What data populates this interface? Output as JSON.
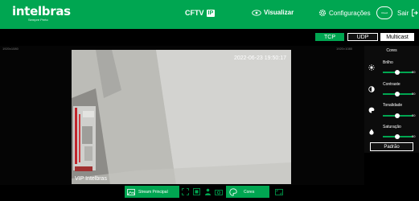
{
  "header": {
    "logo": "intelbras",
    "logo_tagline": "Sempre Perto",
    "product": "CFTV",
    "product_badge": "IP",
    "nav": {
      "visualizar": "Visualizar",
      "configuracoes": "Configurações",
      "cloud": "Cloud",
      "sair": "Sair"
    },
    "accent_color": "#00a651"
  },
  "protocols": {
    "tcp": "TCP",
    "udp": "UDP",
    "multicast": "Multicast",
    "selected": "TCP"
  },
  "video": {
    "timestamp": "2022-06-23 19:50:17",
    "channel_name": "VIP Intelbras",
    "label_left": "1920x1080",
    "label_right": "1920×1080"
  },
  "color_panel": {
    "title": "Cores",
    "sliders": [
      {
        "name": "Brilho",
        "value": 50,
        "icon": "sun-icon"
      },
      {
        "name": "Contraste",
        "value": 50,
        "icon": "contrast-icon"
      },
      {
        "name": "Tonalidade",
        "value": 50,
        "icon": "palette-icon"
      },
      {
        "name": "Saturação",
        "value": 50,
        "icon": "droplet-icon"
      }
    ],
    "reset": "Padrão"
  },
  "bottom": {
    "stream": "Stream Principal",
    "cores": "Cores"
  }
}
